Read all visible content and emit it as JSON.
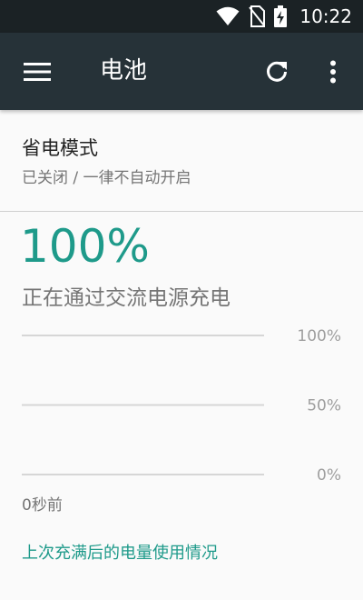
{
  "status_bar": {
    "time": "10:22",
    "icons": [
      "wifi-icon",
      "no-sim-icon",
      "battery-charging-icon"
    ]
  },
  "toolbar": {
    "menu_icon": "menu-icon",
    "title": "电池",
    "refresh_icon": "refresh-icon",
    "more_icon": "more-vert-icon"
  },
  "battery_saver": {
    "title": "省电模式",
    "subtitle": "已关闭 / 一律不自动开启"
  },
  "battery": {
    "level_text": "100%",
    "level": 100,
    "status": "正在通过交流电源充电"
  },
  "chart_data": {
    "type": "line",
    "ytick_labels": [
      "100%",
      "50%",
      "0%"
    ],
    "ylim": [
      0,
      100
    ],
    "x_label": "0秒前",
    "grid": true
  },
  "history_link": "上次充满后的电量使用情况",
  "colors": {
    "accent": "#1e9a8a",
    "toolbar": "#263238",
    "status_bar": "#1b2225"
  }
}
